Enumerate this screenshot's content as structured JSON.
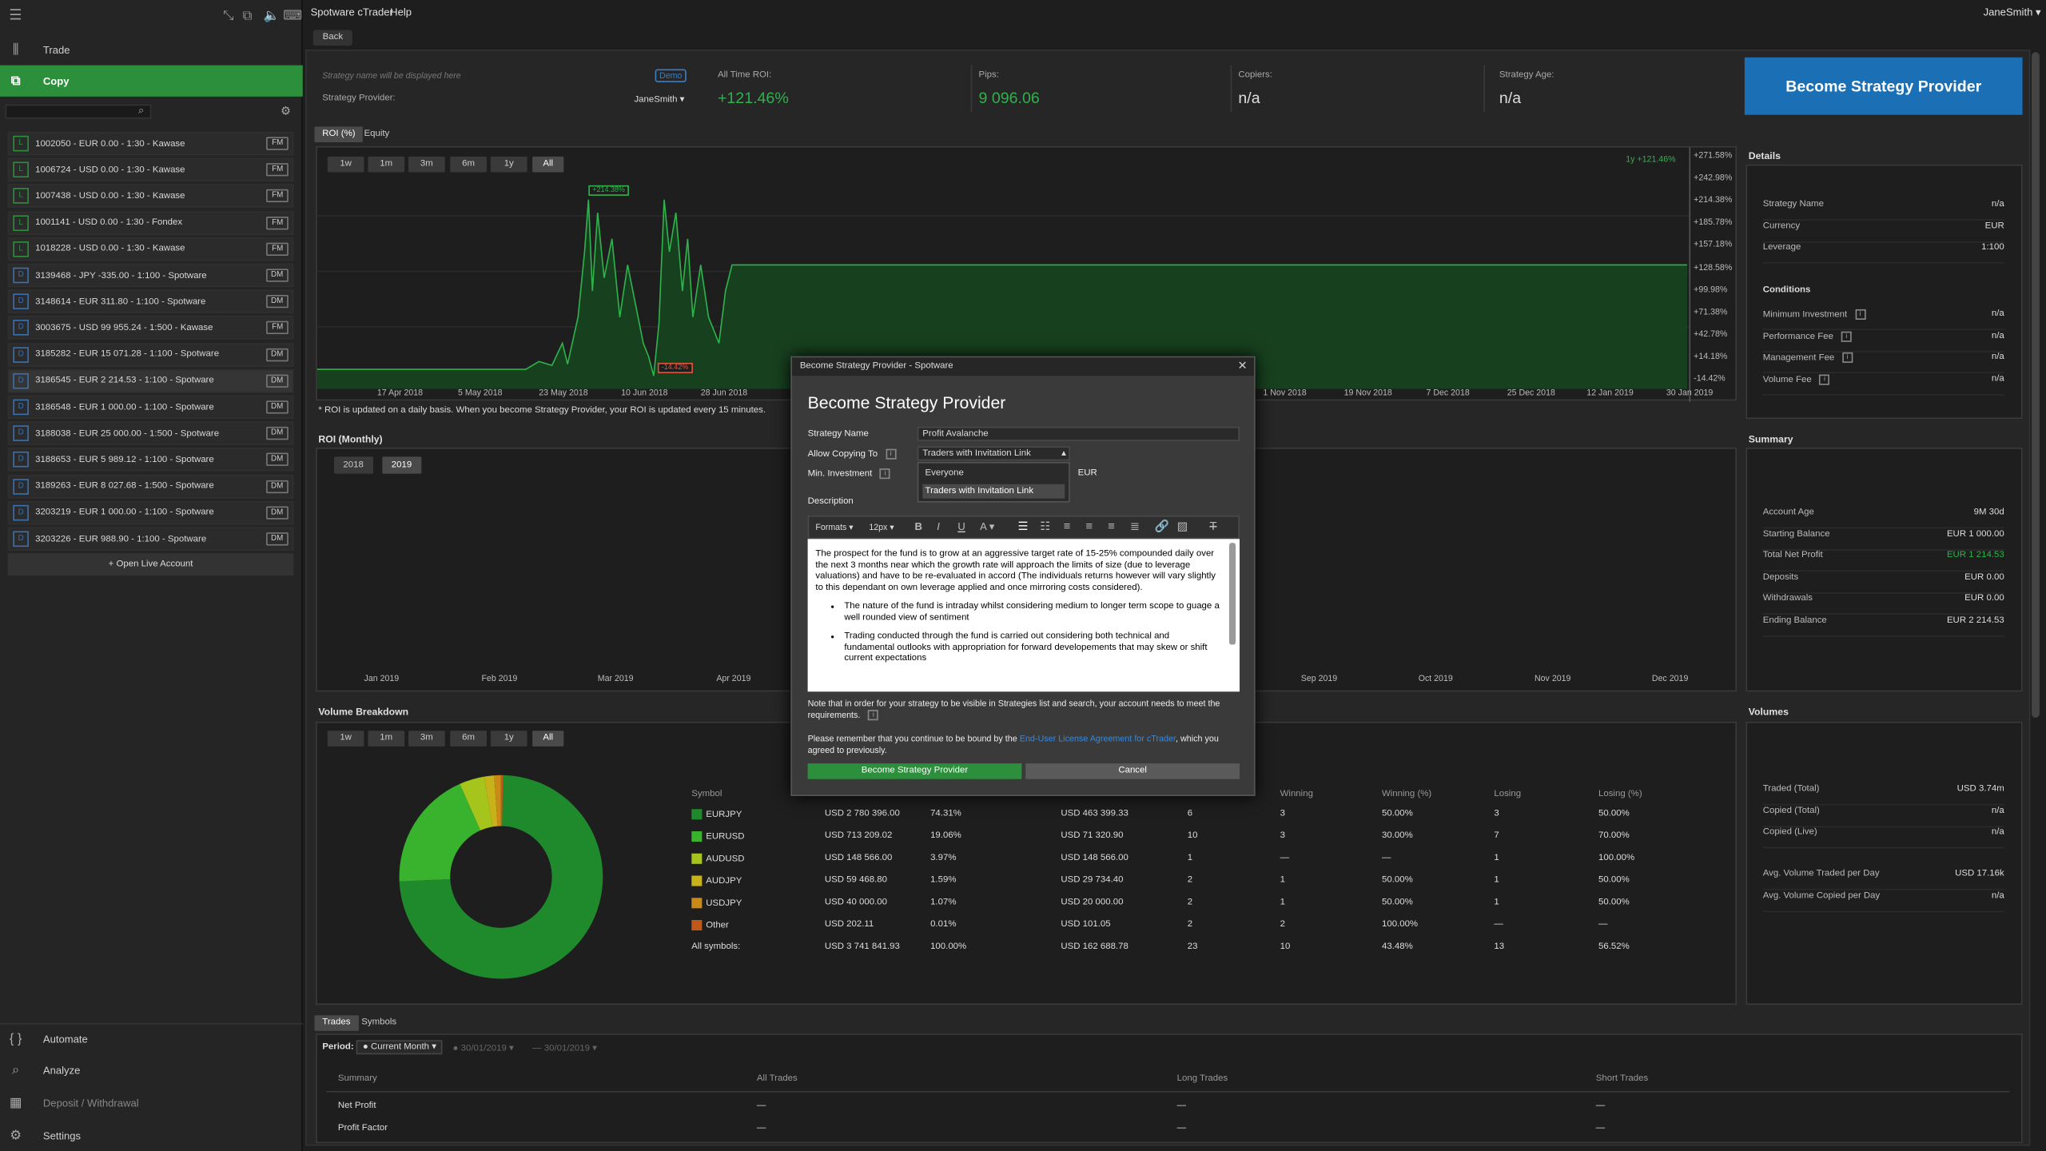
{
  "app": {
    "title": "Spotware cTrader",
    "help": "Help",
    "user": "JaneSmith"
  },
  "sidebar": {
    "nav": [
      {
        "label": "Trade"
      },
      {
        "label": "Copy"
      }
    ],
    "accounts": [
      {
        "type": "L",
        "text": "1002050 - EUR 0.00 - 1:30 - Kawase",
        "badge": "FM"
      },
      {
        "type": "L",
        "text": "1006724 - USD 0.00 - 1:30 - Kawase",
        "badge": "FM"
      },
      {
        "type": "L",
        "text": "1007438 - USD 0.00 - 1:30 - Kawase",
        "badge": "FM"
      },
      {
        "type": "L",
        "text": "1001141 - USD 0.00 - 1:30 - Fondex",
        "badge": "FM"
      },
      {
        "type": "L",
        "text": "1018228 - USD 0.00 - 1:30 - Kawase",
        "badge": "FM"
      },
      {
        "type": "D",
        "text": "3139468 - JPY -335.00 - 1:100 - Spotware",
        "badge": "DM"
      },
      {
        "type": "D",
        "text": "3148614 - EUR 311.80 - 1:100 - Spotware",
        "badge": "DM"
      },
      {
        "type": "D",
        "text": "3003675 - USD 99 955.24 - 1:500 - Kawase",
        "badge": "FM"
      },
      {
        "type": "D",
        "text": "3185282 - EUR 15 071.28 - 1:100 - Spotware",
        "badge": "DM"
      },
      {
        "type": "D",
        "text": "3186545 - EUR 2 214.53 - 1:100 - Spotware",
        "badge": "DM"
      },
      {
        "type": "D",
        "text": "3186548 - EUR 1 000.00 - 1:100 - Spotware",
        "badge": "DM"
      },
      {
        "type": "D",
        "text": "3188038 - EUR 25 000.00 - 1:500 - Spotware",
        "badge": "DM"
      },
      {
        "type": "D",
        "text": "3188653 - EUR 5 989.12 - 1:100 - Spotware",
        "badge": "DM"
      },
      {
        "type": "D",
        "text": "3189263 - EUR 8 027.68 - 1:500 - Spotware",
        "badge": "DM"
      },
      {
        "type": "D",
        "text": "3203219 - EUR 1 000.00 - 1:100 - Spotware",
        "badge": "DM"
      },
      {
        "type": "D",
        "text": "3203226 - EUR 988.90 - 1:100 - Spotware",
        "badge": "DM"
      }
    ],
    "open_live": "+ Open Live Account",
    "bottom": [
      "Automate",
      "Analyze",
      "Deposit / Withdrawal",
      "Settings"
    ]
  },
  "back": "Back",
  "strategy": {
    "name_placeholder": "Strategy name will be displayed here",
    "demo": "Demo",
    "provider_label": "Strategy Provider:",
    "provider": "JaneSmith",
    "roi_label": "All Time ROI:",
    "roi": "+121.46%",
    "pips_label": "Pips:",
    "pips": "9 096.06",
    "copiers_label": "Copiers:",
    "copiers": "n/a",
    "age_label": "Strategy Age:",
    "age": "n/a",
    "become_btn": "Become Strategy Provider"
  },
  "chart_tabs": [
    "ROI (%)",
    "Equity"
  ],
  "ranges": [
    "1w",
    "1m",
    "3m",
    "6m",
    "1y",
    "All"
  ],
  "roi_chart": {
    "chart_data": {
      "type": "area",
      "x": [
        "17 Apr 2018",
        "5 May 2018",
        "23 May 2018",
        "10 Jun 2018",
        "28 Jun 2018",
        "1 Nov 2018",
        "19 Nov 2018",
        "7 Dec 2018",
        "25 Dec 2018",
        "12 Jan 2019",
        "30 Jan 2019"
      ],
      "yticks": [
        "+271.58%",
        "+242.98%",
        "+214.38%",
        "+185.78%",
        "+157.18%",
        "+128.58%",
        "+99.98%",
        "+71.38%",
        "+42.78%",
        "+14.18%",
        "-14.42%"
      ],
      "max_label": "+214.38%",
      "min_label": "-14.42%",
      "legend": "1y +121.46%"
    },
    "note": "* ROI is updated on a daily basis. When you become Strategy Provider, your ROI is updated every 15 minutes."
  },
  "roi_monthly": {
    "title": "ROI (Monthly)",
    "years": [
      "2018",
      "2019"
    ],
    "months": [
      "Jan 2019",
      "Feb 2019",
      "Mar 2019",
      "Apr 2019",
      "Sep 2019",
      "Oct 2019",
      "Nov 2019",
      "Dec 2019"
    ]
  },
  "details": {
    "title": "Details",
    "rows": [
      {
        "k": "Strategy Name",
        "v": "n/a"
      },
      {
        "k": "Currency",
        "v": "EUR"
      },
      {
        "k": "Leverage",
        "v": "1:100"
      }
    ],
    "conditions_title": "Conditions",
    "conditions": [
      {
        "k": "Minimum Investment",
        "v": "n/a"
      },
      {
        "k": "Performance Fee",
        "v": "n/a"
      },
      {
        "k": "Management Fee",
        "v": "n/a"
      },
      {
        "k": "Volume Fee",
        "v": "n/a"
      }
    ]
  },
  "summary": {
    "title": "Summary",
    "rows": [
      {
        "k": "Account Age",
        "v": "9M 30d"
      },
      {
        "k": "Starting Balance",
        "v": "EUR 1 000.00"
      },
      {
        "k": "Total Net Profit",
        "v": "EUR 1 214.53"
      },
      {
        "k": "Deposits",
        "v": "EUR 0.00"
      },
      {
        "k": "Withdrawals",
        "v": "EUR 0.00"
      },
      {
        "k": "Ending Balance",
        "v": "EUR 2 214.53"
      }
    ]
  },
  "volumes": {
    "title": "Volumes",
    "rows": [
      {
        "k": "Traded (Total)",
        "v": "USD 3.74m"
      },
      {
        "k": "Copied (Total)",
        "v": "n/a"
      },
      {
        "k": "Copied (Live)",
        "v": "n/a"
      },
      {
        "k": "Avg. Volume Traded per Day",
        "v": "USD 17.16k"
      },
      {
        "k": "Avg. Volume Copied per Day",
        "v": "n/a"
      }
    ]
  },
  "volume_breakdown": {
    "title": "Volume Breakdown",
    "headers": [
      "Symbol",
      "",
      "",
      "",
      "",
      "Winning",
      "Winning (%)",
      "Losing",
      "Losing (%)"
    ],
    "rows": [
      {
        "sym": "EURJPY",
        "color": "#1f8a2c",
        "vol": "USD 2 780 396.00",
        "pct": "74.31%",
        "v2": "USD 463 399.33",
        "n": "6",
        "w": "3",
        "wp": "50.00%",
        "l": "3",
        "lp": "50.00%"
      },
      {
        "sym": "EURUSD",
        "color": "#39b22d",
        "vol": "USD 713 209.02",
        "pct": "19.06%",
        "v2": "USD 71 320.90",
        "n": "10",
        "w": "3",
        "wp": "30.00%",
        "l": "7",
        "lp": "70.00%"
      },
      {
        "sym": "AUDUSD",
        "color": "#a6c51c",
        "vol": "USD 148 566.00",
        "pct": "3.97%",
        "v2": "USD 148 566.00",
        "n": "1",
        "w": "—",
        "wp": "—",
        "l": "1",
        "lp": "100.00%"
      },
      {
        "sym": "AUDJPY",
        "color": "#c8b21a",
        "vol": "USD 59 468.80",
        "pct": "1.59%",
        "v2": "USD 29 734.40",
        "n": "2",
        "w": "1",
        "wp": "50.00%",
        "l": "1",
        "lp": "50.00%"
      },
      {
        "sym": "USDJPY",
        "color": "#c98a18",
        "vol": "USD 40 000.00",
        "pct": "1.07%",
        "v2": "USD 20 000.00",
        "n": "2",
        "w": "1",
        "wp": "50.00%",
        "l": "1",
        "lp": "50.00%"
      },
      {
        "sym": "Other",
        "color": "#c2571a",
        "vol": "USD 202.11",
        "pct": "0.01%",
        "v2": "USD 101.05",
        "n": "2",
        "w": "2",
        "wp": "100.00%",
        "l": "—",
        "lp": "—"
      },
      {
        "sym": "All symbols:",
        "color": "",
        "vol": "USD 3 741 841.93",
        "pct": "100.00%",
        "v2": "USD 162 688.78",
        "n": "23",
        "w": "10",
        "wp": "43.48%",
        "l": "13",
        "lp": "56.52%"
      }
    ],
    "chart_data": {
      "type": "pie",
      "categories": [
        "EURJPY",
        "EURUSD",
        "AUDUSD",
        "AUDJPY",
        "USDJPY",
        "Other"
      ],
      "values": [
        74.31,
        19.06,
        3.97,
        1.59,
        1.07,
        0.01
      ]
    }
  },
  "trades": {
    "tabs": [
      "Trades",
      "Symbols"
    ],
    "period_label": "Period:",
    "period": "Current Month",
    "date_from": "30/01/2019",
    "date_to": "30/01/2019",
    "headers": [
      "Summary",
      "All Trades",
      "Long Trades",
      "Short Trades"
    ],
    "rows": [
      {
        "k": "Net Profit",
        "a": "—",
        "b": "—",
        "c": "—"
      },
      {
        "k": "Profit Factor",
        "a": "—",
        "b": "—",
        "c": "—"
      }
    ]
  },
  "modal": {
    "window_title": "Become Strategy Provider - Spotware",
    "heading": "Become Strategy Provider",
    "name_label": "Strategy Name",
    "name_value": "Profit Avalanche",
    "allow_label": "Allow Copying To",
    "allow_value": "Traders with Invitation Link",
    "allow_options": [
      "Everyone",
      "Traders with Invitation Link"
    ],
    "min_label": "Min. Investment",
    "currency": "EUR",
    "desc_label": "Description",
    "toolbar": {
      "formats": "Formats",
      "size": "12px"
    },
    "desc_p": "The prospect for the fund is to grow at an aggressive target rate of 15-25% compounded daily over the next 3 months near which the growth rate will approach the limits of size (due to leverage valuations) and have to be re-evaluated in accord (The individuals returns however will vary slightly to this dependant on own leverage applied and once mirroring costs considered).",
    "desc_li": [
      "The nature of the fund is intraday whilst considering medium to longer term scope to guage a well rounded view of sentiment",
      "Trading conducted through the fund is carried out considering both technical and fundamental outlooks with appropriation for forward developements that may skew or shift current expectations"
    ],
    "note1": "Note that in order for your strategy to be visible in Strategies list and search, your account needs to meet the requirements.",
    "note2_a": "Please remember that you continue to be bound by the ",
    "note2_link": "End-User License Agreement for cTrader",
    "note2_b": ", which you agreed to previously.",
    "ok": "Become Strategy Provider",
    "cancel": "Cancel"
  }
}
